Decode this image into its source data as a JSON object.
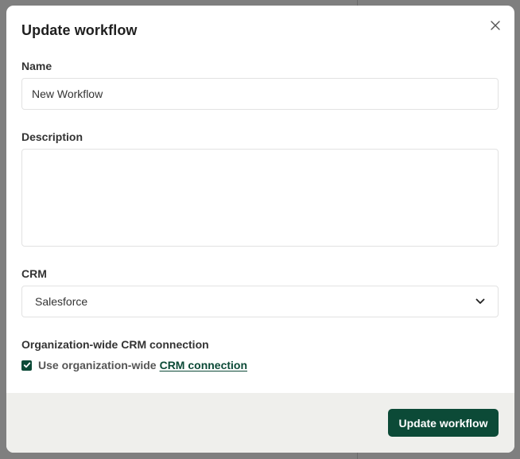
{
  "modal": {
    "title": "Update workflow",
    "close_icon": "close-icon"
  },
  "form": {
    "name": {
      "label": "Name",
      "value": "New Workflow"
    },
    "description": {
      "label": "Description",
      "value": ""
    },
    "crm": {
      "label": "CRM",
      "selected": "Salesforce"
    },
    "org_connection": {
      "label": "Organization-wide CRM connection",
      "checkbox_checked": true,
      "checkbox_text": "Use organization-wide",
      "link_text": "CRM connection"
    }
  },
  "footer": {
    "submit_label": "Update workflow"
  },
  "colors": {
    "primary": "#0c4a37",
    "footer_bg": "#efefec",
    "overlay": "#7f7f7f"
  }
}
